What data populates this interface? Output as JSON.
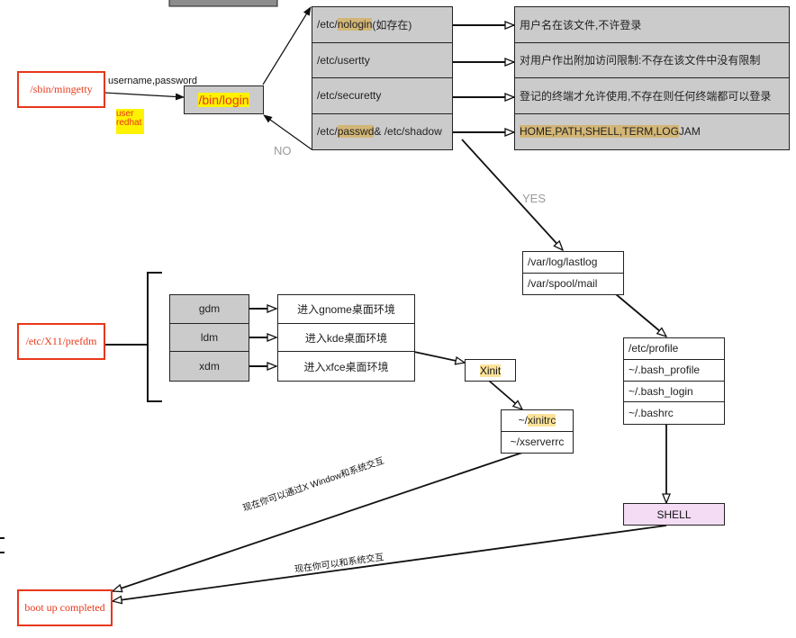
{
  "top_partial_box": {
    "label": ""
  },
  "mingetty": {
    "label": "/sbin/mingetty"
  },
  "login_edge_label": "username,password",
  "credentials_note": {
    "line1": "user",
    "line2": "redhat"
  },
  "bin_login": {
    "label": "/bin/login"
  },
  "no_label": "NO",
  "yes_label": "YES",
  "login_checks": [
    {
      "prefix": "/etc/",
      "highlight": "nologin",
      "suffix": "(如存在)"
    },
    {
      "prefix": "/etc/usertty",
      "highlight": "",
      "suffix": ""
    },
    {
      "prefix": "/etc/securetty",
      "highlight": "",
      "suffix": ""
    },
    {
      "prefix": "/etc/",
      "highlight": "passwd",
      "suffix": " & /etc/shadow"
    }
  ],
  "check_descriptions": [
    {
      "highlight": "",
      "text": "用户名在该文件,不许登录"
    },
    {
      "highlight": "",
      "text": "对用户作出附加访问限制:不存在该文件中没有限制"
    },
    {
      "highlight": "",
      "text": "登记的终端才允许使用,不存在则任何终端都可以登录"
    },
    {
      "highlight": "HOME,PATH,SHELL,TERM,LOG",
      "text": "JAM"
    }
  ],
  "var_files": [
    "/var/log/lastlog",
    "/var/spool/mail"
  ],
  "profile_files": [
    "/etc/profile",
    "~/.bash_profile",
    "~/.bash_login",
    "~/.bashrc"
  ],
  "shell": {
    "label": "SHELL",
    "color": "#f4dcf4"
  },
  "prefdm": {
    "label": "/etc/X11/prefdm"
  },
  "display_managers": [
    "gdm",
    "ldm",
    "xdm"
  ],
  "desktops": [
    "进入gnome桌面环境",
    "进入kde桌面环境",
    "进入xfce桌面环境"
  ],
  "xinit": {
    "label": "Xinit"
  },
  "x_files": [
    {
      "prefix": "~/",
      "highlight": "xinitrc"
    },
    {
      "prefix": "~/xserverrc",
      "highlight": ""
    }
  ],
  "x_window_edge_label": "现在你可以通过X Window和系统交互",
  "shell_edge_label": "现在你可以和系统交互",
  "boot_completed": {
    "label": "boot up completed"
  },
  "colors": {
    "red_border": "#e8371a",
    "gray_fill": "#cbcbcb",
    "tan_highlight": "#d3b676",
    "yellow_highlight": "#fdf200"
  }
}
